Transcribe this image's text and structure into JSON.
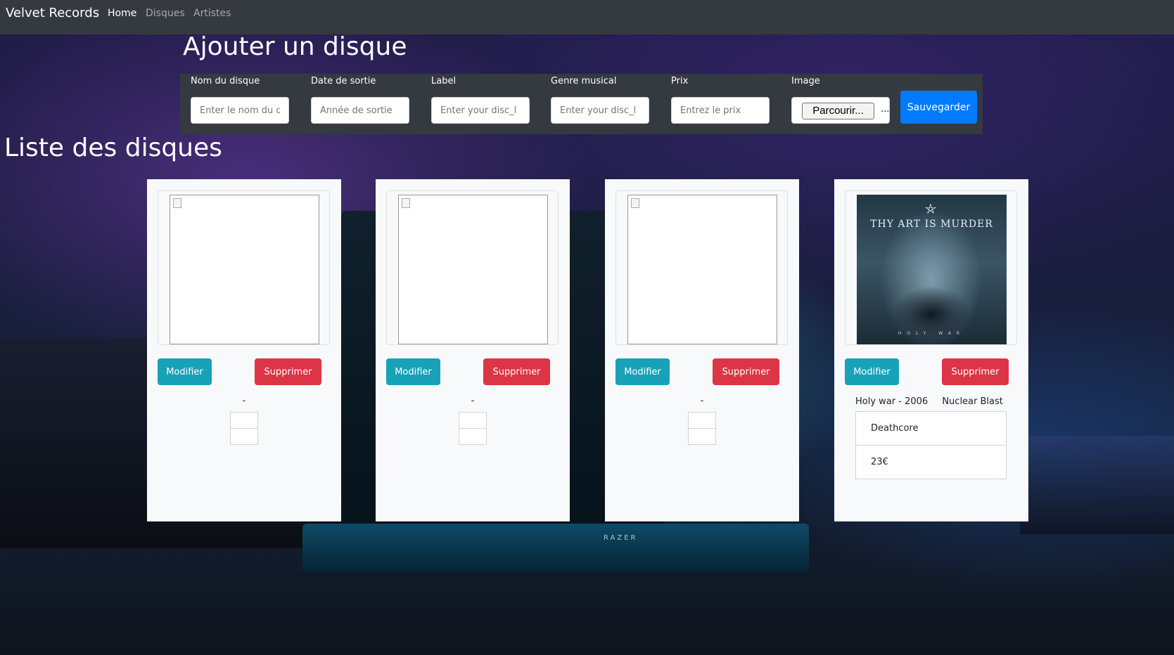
{
  "nav": {
    "brand": "Velvet Records",
    "links": [
      "Home",
      "Disques",
      "Artistes"
    ]
  },
  "form": {
    "title": "Ajouter un disque",
    "fields": [
      {
        "label": "Nom du disque",
        "placeholder": "Enter le nom du d"
      },
      {
        "label": "Date de sortie",
        "placeholder": "Année de sortie"
      },
      {
        "label": "Label",
        "placeholder": "Enter your disc_l"
      },
      {
        "label": "Genre musical",
        "placeholder": "Enter your disc_l"
      },
      {
        "label": "Prix",
        "placeholder": "Entrez le prix"
      },
      {
        "label": "Image",
        "file_button": "Parcourir...",
        "file_status": "..."
      }
    ],
    "save_label": "Sauvegarder"
  },
  "list": {
    "title": "Liste des disques",
    "edit_label": "Modifier",
    "delete_label": "Supprimer",
    "cards": [
      {
        "has_image": false,
        "meta": "-"
      },
      {
        "has_image": false,
        "meta": "-"
      },
      {
        "has_image": false,
        "meta": "-"
      },
      {
        "has_image": true,
        "album_logo": "THY ART IS MURDER",
        "album_subtitle": "HOLY WAR",
        "title": "Holy war",
        "year": "2006",
        "label": "Nuclear Blast",
        "genre": "Deathcore",
        "price": "23€"
      }
    ]
  },
  "background": {
    "watermark": "RAZER"
  }
}
